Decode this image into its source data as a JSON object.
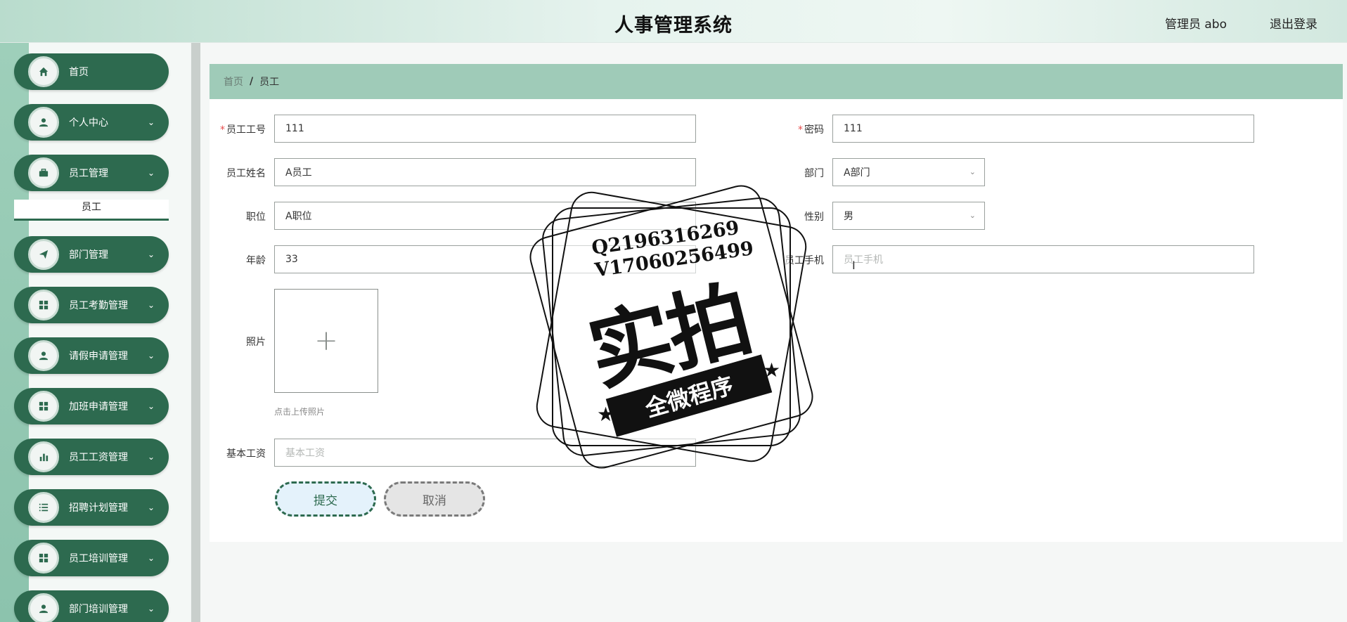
{
  "header": {
    "title": "人事管理系统",
    "admin": "管理员 abo",
    "logout": "退出登录"
  },
  "sidebar": {
    "items": [
      {
        "label": "首页",
        "icon": "home-icon",
        "expandable": false
      },
      {
        "label": "个人中心",
        "icon": "user-icon",
        "expandable": true
      },
      {
        "label": "员工管理",
        "icon": "briefcase-icon",
        "expandable": true
      },
      {
        "label": "部门管理",
        "icon": "send-icon",
        "expandable": true
      },
      {
        "label": "员工考勤管理",
        "icon": "grid-icon",
        "expandable": true
      },
      {
        "label": "请假申请管理",
        "icon": "user-icon",
        "expandable": true
      },
      {
        "label": "加班申请管理",
        "icon": "grid-icon",
        "expandable": true
      },
      {
        "label": "员工工资管理",
        "icon": "bar-chart-icon",
        "expandable": true
      },
      {
        "label": "招聘计划管理",
        "icon": "list-icon",
        "expandable": true
      },
      {
        "label": "员工培训管理",
        "icon": "grid-icon",
        "expandable": true
      },
      {
        "label": "部门培训管理",
        "icon": "user-icon",
        "expandable": true
      }
    ],
    "submenu": {
      "label": "员工"
    },
    "chevron": "⌄"
  },
  "breadcrumb": {
    "home": "首页",
    "separator": "/",
    "current": "员工"
  },
  "form": {
    "emp_no": {
      "label": "员工工号",
      "value": "111",
      "required": true
    },
    "password": {
      "label": "密码",
      "value": "111",
      "required": true
    },
    "emp_name": {
      "label": "员工姓名",
      "value": "A员工"
    },
    "department": {
      "label": "部门",
      "value": "A部门"
    },
    "position": {
      "label": "职位",
      "value": "A职位"
    },
    "gender": {
      "label": "性别",
      "value": "男"
    },
    "age": {
      "label": "年龄",
      "value": "33"
    },
    "phone": {
      "label": "员工手机",
      "placeholder": "员工手机",
      "value": ""
    },
    "photo": {
      "label": "照片",
      "hint": "点击上传照片",
      "plus": "+"
    },
    "salary": {
      "label": "基本工资",
      "placeholder": "基本工资",
      "value": ""
    },
    "required_mark": "*"
  },
  "buttons": {
    "submit": "提交",
    "cancel": "取消"
  },
  "cursor_glyph": "I",
  "watermark": {
    "line1": "Q2196316269",
    "line2": "V17060256499",
    "big": "实拍",
    "banner": "全微程序",
    "star": "★"
  },
  "colors": {
    "sidebar_item": "#2d6a4f",
    "breadcrumb_bg": "#9fcbb8",
    "required": "#e64c4c"
  }
}
